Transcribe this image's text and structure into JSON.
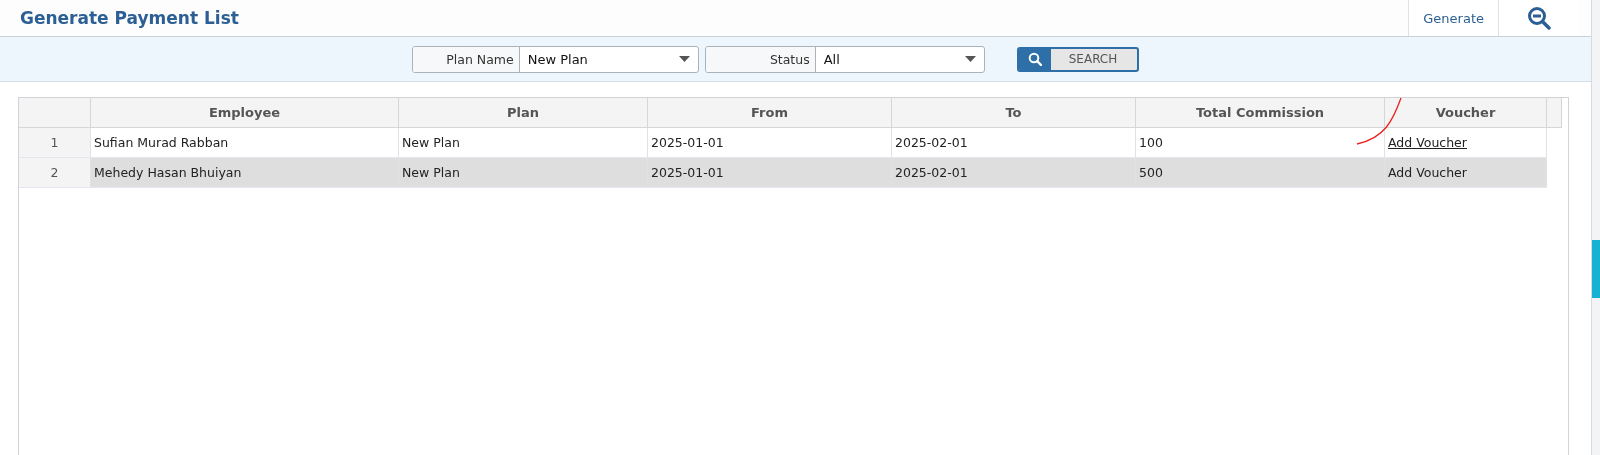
{
  "title": "Generate Payment List",
  "toolbar": {
    "generate": "Generate"
  },
  "filters": [
    {
      "label": "Plan Name",
      "value": "New Plan"
    },
    {
      "label": "Status",
      "value": "All"
    }
  ],
  "search_button": "SEARCH",
  "table": {
    "columns": [
      "",
      "Employee",
      "Plan",
      "From",
      "To",
      "Total Commission",
      "Voucher"
    ],
    "rows": [
      {
        "index": "1",
        "employee": "Sufian Murad Rabban",
        "plan": "New Plan",
        "from": "2025-01-01",
        "to": "2025-02-01",
        "commission": "100",
        "voucher": "Add Voucher",
        "selected": false,
        "hovered": true
      },
      {
        "index": "2",
        "employee": "Mehedy Hasan Bhuiyan",
        "plan": "New Plan",
        "from": "2025-01-01",
        "to": "2025-02-01",
        "commission": "500",
        "voucher": "Add Voucher",
        "selected": true,
        "hovered": false
      }
    ]
  },
  "annotation": {
    "kind": "pen-stroke",
    "color": "#e8231e"
  }
}
